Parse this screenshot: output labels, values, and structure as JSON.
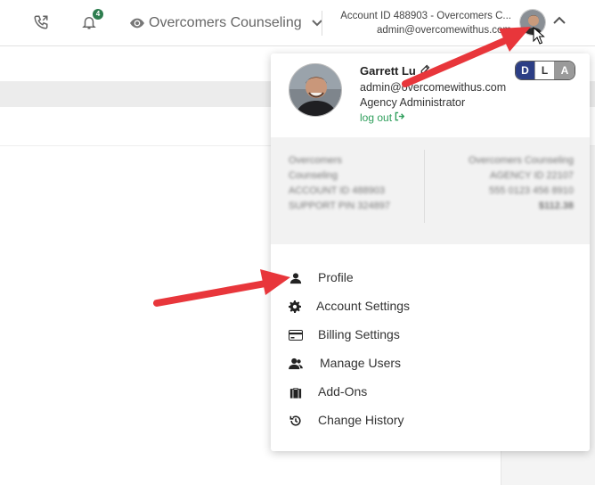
{
  "topbar": {
    "notification_count": "4",
    "agency_name": "Overcomers Counseling",
    "account_line": "Account ID 488903  -  Overcomers C...",
    "account_email": "admin@overcomewithus.com"
  },
  "profile": {
    "name": "Garrett Lu",
    "email": "admin@overcomewithus.com",
    "role": "Agency Administrator",
    "logout_label": "log out"
  },
  "mode_toggle": [
    "D",
    "L",
    "A"
  ],
  "blurred": {
    "left_title": "Overcomers Counseling",
    "left_line1": "ACCOUNT ID 488903",
    "left_line2": "SUPPORT PIN 324897",
    "right_title": "Overcomers Counseling",
    "right_line1": "AGENCY ID 22107",
    "right_line2": "555 0123 456 8910",
    "right_line3": "$112.38"
  },
  "menu": [
    {
      "label": "Profile",
      "icon": "user-icon"
    },
    {
      "label": "Account Settings",
      "icon": "gear-icon"
    },
    {
      "label": "Billing Settings",
      "icon": "credit-card-icon"
    },
    {
      "label": "Manage Users",
      "icon": "users-icon"
    },
    {
      "label": "Add-Ons",
      "icon": "briefcase-icon"
    },
    {
      "label": "Change History",
      "icon": "history-icon"
    }
  ],
  "colors": {
    "accent_green": "#2e9e5b",
    "toggle_dark": "#2c3e85",
    "arrow_red": "#e8363b"
  }
}
